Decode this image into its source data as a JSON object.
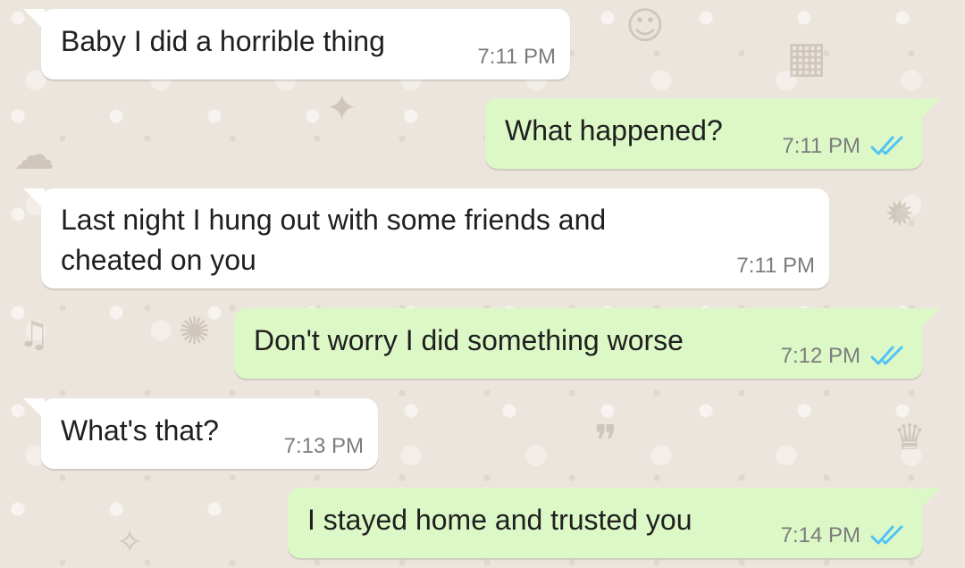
{
  "chat": {
    "colors": {
      "background": "#ece5dd",
      "incoming_bubble": "#ffffff",
      "outgoing_bubble": "#dcf8c6",
      "read_ticks": "#4fc3f7",
      "time_text": "#7c7c7c"
    },
    "messages": [
      {
        "direction": "incoming",
        "text": "Baby I did a horrible thing",
        "time": "7:11 PM"
      },
      {
        "direction": "outgoing",
        "text": "What happened?",
        "time": "7:11 PM",
        "status": "read",
        "status_icon": "double-check-icon"
      },
      {
        "direction": "incoming",
        "text": "Last night I hung out with some friends and\ncheated on you",
        "time": "7:11 PM"
      },
      {
        "direction": "outgoing",
        "text": "Don't worry I did something worse",
        "time": "7:12 PM",
        "status": "read",
        "status_icon": "double-check-icon"
      },
      {
        "direction": "incoming",
        "text": "What's that?",
        "time": "7:13 PM"
      },
      {
        "direction": "outgoing",
        "text": "I stayed home and trusted you",
        "time": "7:14 PM",
        "status": "read",
        "status_icon": "double-check-icon"
      }
    ]
  }
}
